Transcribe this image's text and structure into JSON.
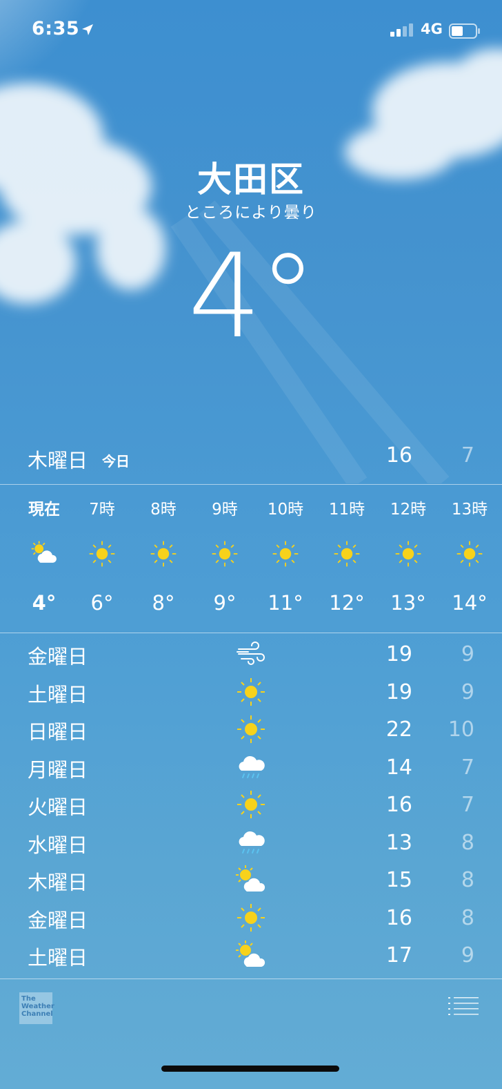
{
  "status": {
    "time": "6:35",
    "network": "4G"
  },
  "location": {
    "city": "大田区",
    "condition": "ところにより曇り",
    "temperature": "4°"
  },
  "today": {
    "day": "木曜日",
    "label": "今日",
    "high": "16",
    "low": "7"
  },
  "hourly": [
    {
      "label": "現在",
      "icon": "partly-cloudy-icon",
      "temp": "4°"
    },
    {
      "label": "7時",
      "icon": "sun-icon",
      "temp": "6°"
    },
    {
      "label": "8時",
      "icon": "sun-icon",
      "temp": "8°"
    },
    {
      "label": "9時",
      "icon": "sun-icon",
      "temp": "9°"
    },
    {
      "label": "10時",
      "icon": "sun-icon",
      "temp": "11°"
    },
    {
      "label": "11時",
      "icon": "sun-icon",
      "temp": "12°"
    },
    {
      "label": "12時",
      "icon": "sun-icon",
      "temp": "13°"
    },
    {
      "label": "13時",
      "icon": "sun-icon",
      "temp": "14°"
    }
  ],
  "daily": [
    {
      "day": "金曜日",
      "icon": "wind-icon",
      "high": "19",
      "low": "9"
    },
    {
      "day": "土曜日",
      "icon": "sun-icon",
      "high": "19",
      "low": "9"
    },
    {
      "day": "日曜日",
      "icon": "sun-icon",
      "high": "22",
      "low": "10"
    },
    {
      "day": "月曜日",
      "icon": "rain-icon",
      "high": "14",
      "low": "7"
    },
    {
      "day": "火曜日",
      "icon": "sun-icon",
      "high": "16",
      "low": "7"
    },
    {
      "day": "水曜日",
      "icon": "rain-icon",
      "high": "13",
      "low": "8"
    },
    {
      "day": "木曜日",
      "icon": "partly-cloudy-icon",
      "high": "15",
      "low": "8"
    },
    {
      "day": "金曜日",
      "icon": "sun-icon",
      "high": "16",
      "low": "8"
    },
    {
      "day": "土曜日",
      "icon": "partly-cloudy-icon",
      "high": "17",
      "low": "9"
    }
  ],
  "footer": {
    "provider_logo": [
      "The",
      "Weather",
      "Channel"
    ]
  },
  "colors": {
    "sun": "#f7d21b",
    "sky": "#4593cf",
    "rain": "#5bc3f0"
  }
}
